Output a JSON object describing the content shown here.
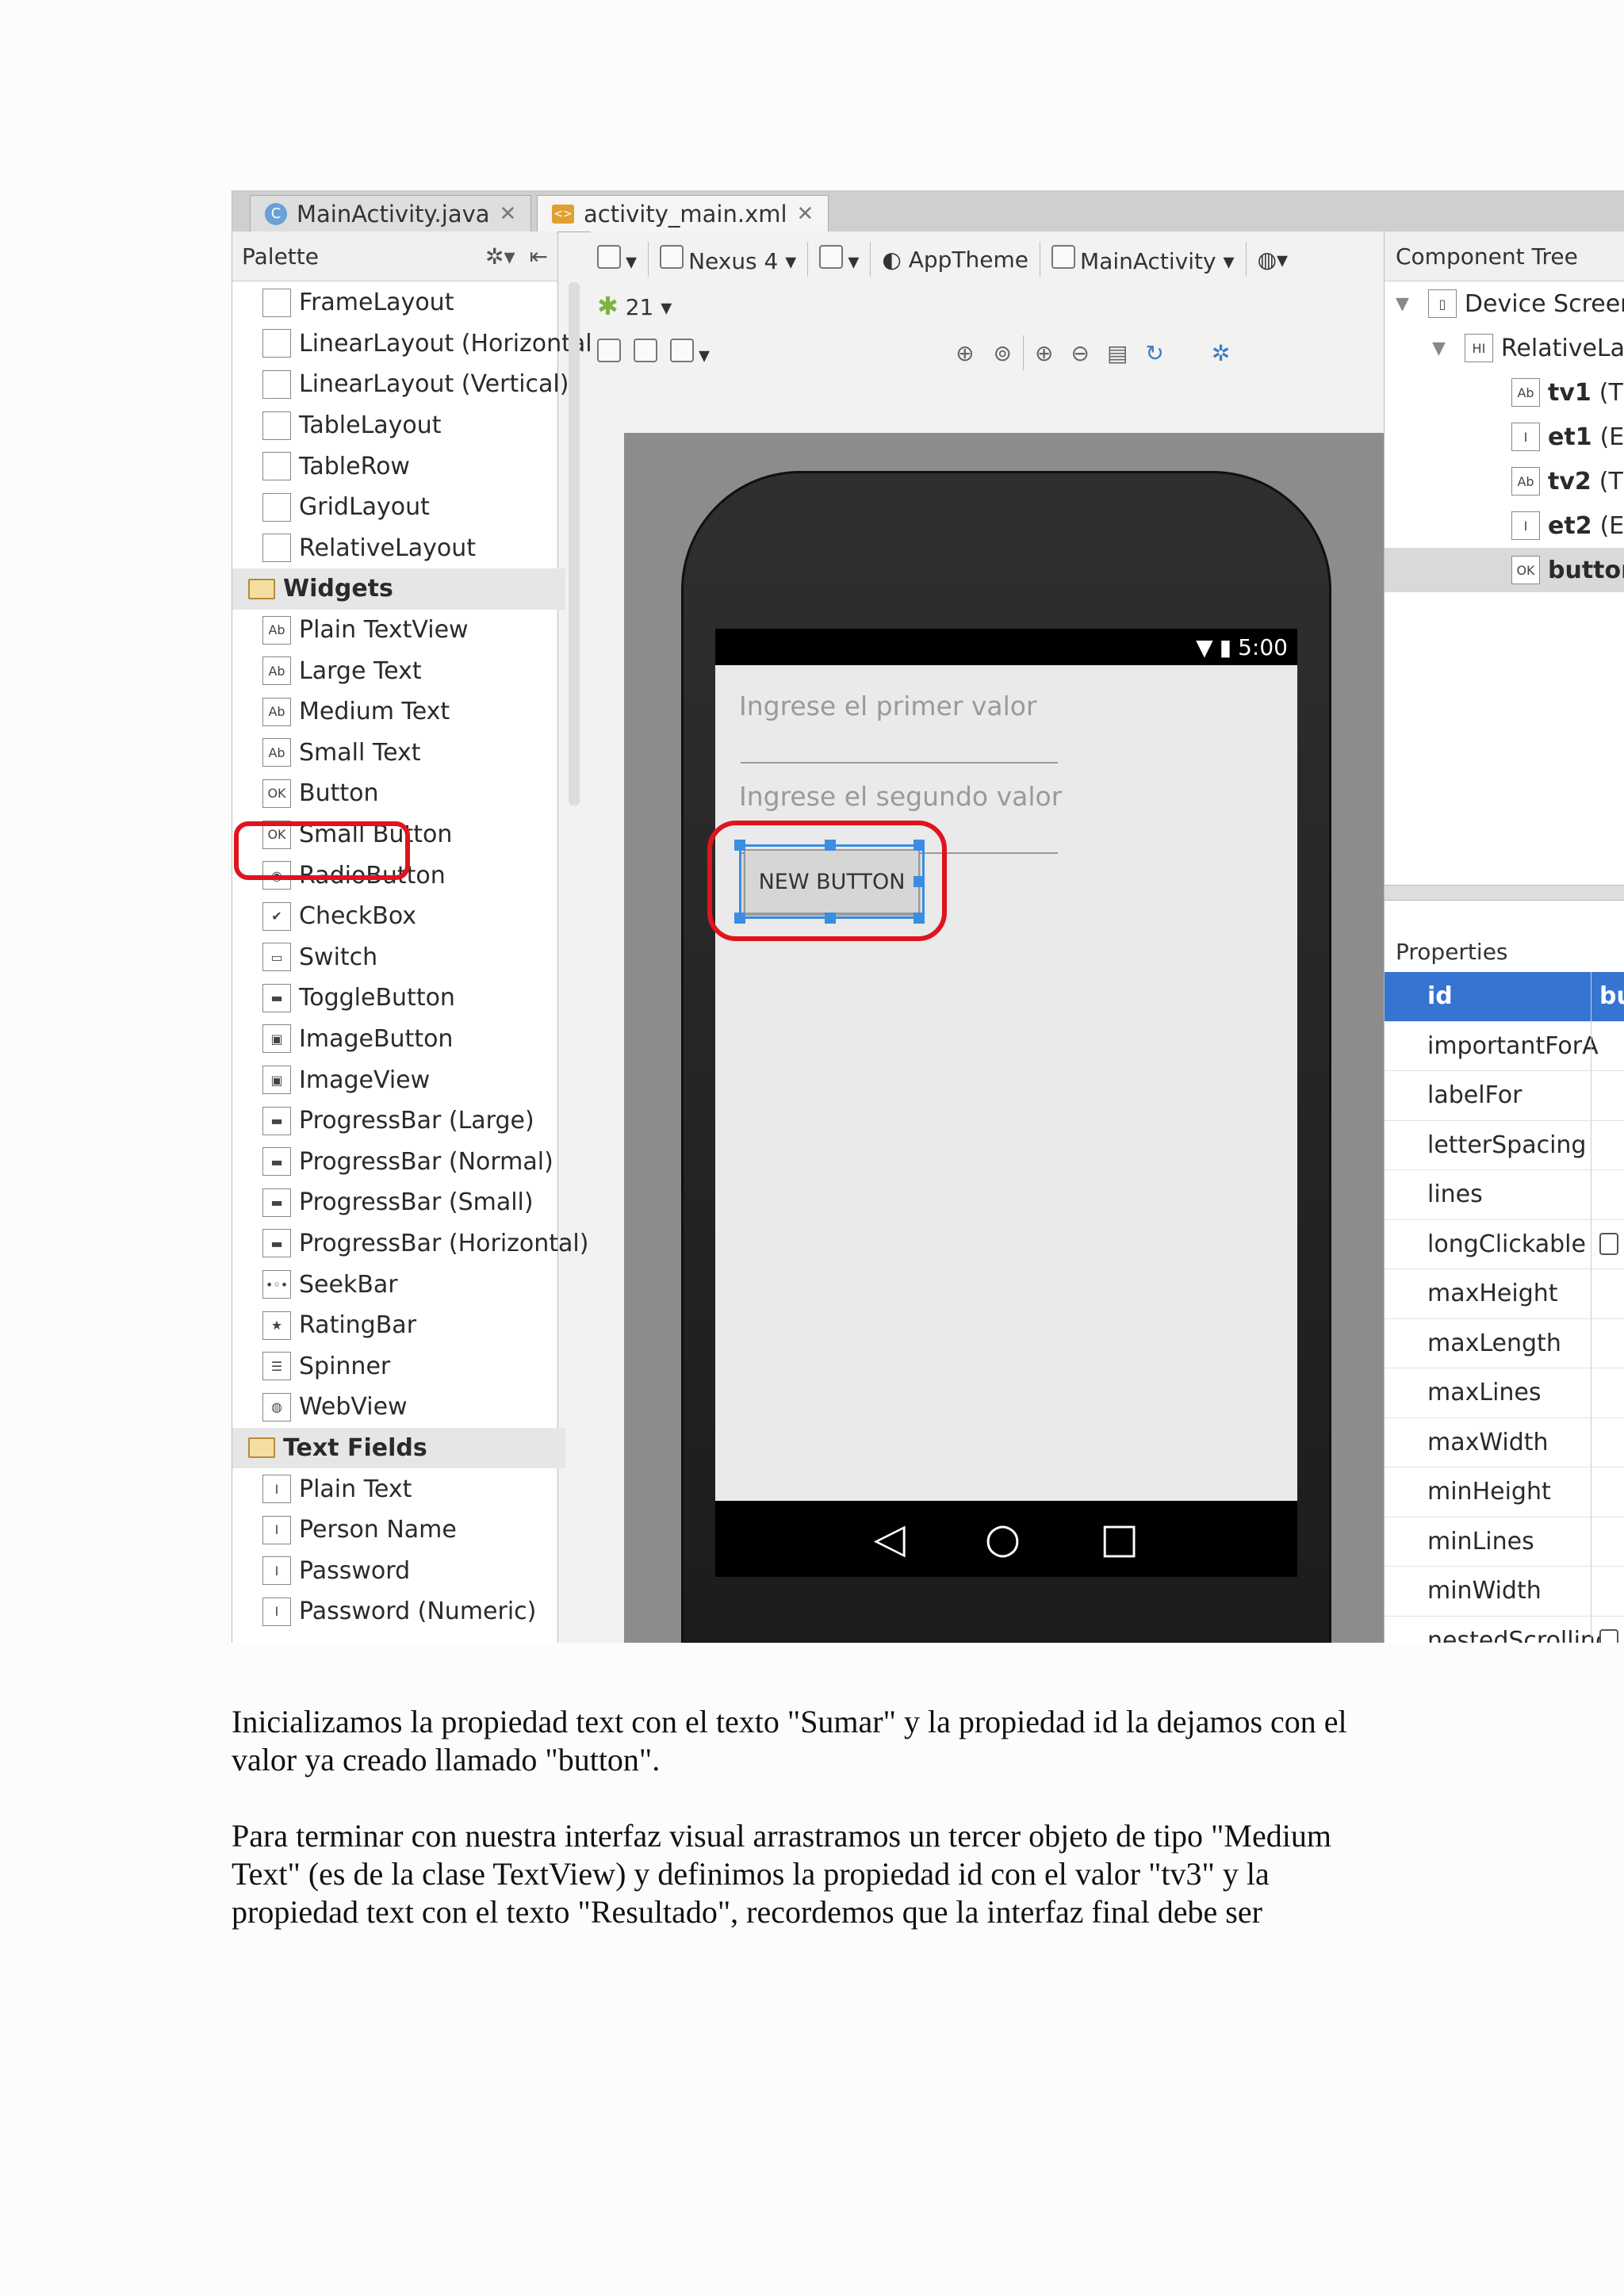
{
  "tabs": [
    {
      "label": "MainActivity.java",
      "icon": "c-class-icon"
    },
    {
      "label": "activity_main.xml",
      "icon": "xml-layout-icon"
    }
  ],
  "palette": {
    "title": "Palette",
    "items": [
      {
        "label": "FrameLayout",
        "glyph": ""
      },
      {
        "label": "LinearLayout (Horizontal",
        "glyph": ""
      },
      {
        "label": "LinearLayout (Vertical)",
        "glyph": ""
      },
      {
        "label": "TableLayout",
        "glyph": ""
      },
      {
        "label": "TableRow",
        "glyph": ""
      },
      {
        "label": "GridLayout",
        "glyph": ""
      },
      {
        "label": "RelativeLayout",
        "glyph": ""
      },
      {
        "label": "Widgets",
        "category": true
      },
      {
        "label": "Plain TextView",
        "glyph": "Ab"
      },
      {
        "label": "Large Text",
        "glyph": "Ab"
      },
      {
        "label": "Medium Text",
        "glyph": "Ab"
      },
      {
        "label": "Small Text",
        "glyph": "Ab"
      },
      {
        "label": "Button",
        "glyph": "OK"
      },
      {
        "label": "Small Button",
        "glyph": "OK"
      },
      {
        "label": "RadioButton",
        "glyph": "◉"
      },
      {
        "label": "CheckBox",
        "glyph": "✔"
      },
      {
        "label": "Switch",
        "glyph": "▭"
      },
      {
        "label": "ToggleButton",
        "glyph": "▬"
      },
      {
        "label": "ImageButton",
        "glyph": "▣"
      },
      {
        "label": "ImageView",
        "glyph": "▣"
      },
      {
        "label": "ProgressBar (Large)",
        "glyph": "▬"
      },
      {
        "label": "ProgressBar (Normal)",
        "glyph": "▬"
      },
      {
        "label": "ProgressBar (Small)",
        "glyph": "▬"
      },
      {
        "label": "ProgressBar (Horizontal)",
        "glyph": "▬"
      },
      {
        "label": "SeekBar",
        "glyph": "•◦•"
      },
      {
        "label": "RatingBar",
        "glyph": "★"
      },
      {
        "label": "Spinner",
        "glyph": "☰"
      },
      {
        "label": "WebView",
        "glyph": "◍"
      },
      {
        "label": "Text Fields",
        "category": true
      },
      {
        "label": "Plain Text",
        "glyph": "I"
      },
      {
        "label": "Person Name",
        "glyph": "I"
      },
      {
        "label": "Password",
        "glyph": "I"
      },
      {
        "label": "Password (Numeric)",
        "glyph": "I"
      }
    ]
  },
  "toolbar": {
    "device": "Nexus 4",
    "theme": "AppTheme",
    "activity": "MainActivity",
    "api": "21"
  },
  "phone": {
    "time": "5:00",
    "hint1": "Ingrese el primer valor",
    "hint2": "Ingrese el segundo valor",
    "button": "NEW BUTTON"
  },
  "component_tree": {
    "title": "Component Tree",
    "items": [
      {
        "label": "Device Screen",
        "bold": "",
        "rest": "Device Screen",
        "glyph": "▯"
      },
      {
        "label": "RelativeLay",
        "bold": "",
        "rest": "RelativeLay",
        "glyph": "HI"
      },
      {
        "bold": "tv1",
        "rest": " (T",
        "glyph": "Ab"
      },
      {
        "bold": "et1",
        "rest": " (Ec",
        "glyph": "I"
      },
      {
        "bold": "tv2",
        "rest": " (T",
        "glyph": "Ab"
      },
      {
        "bold": "et2",
        "rest": " (Ec",
        "glyph": "I"
      },
      {
        "bold": "buttor",
        "rest": "",
        "glyph": "OK"
      }
    ]
  },
  "properties": {
    "title": "Properties",
    "rows": [
      {
        "name": "id",
        "value": "bu"
      },
      {
        "name": "importantForA",
        "value": ""
      },
      {
        "name": "labelFor",
        "value": ""
      },
      {
        "name": "letterSpacing",
        "value": ""
      },
      {
        "name": "lines",
        "value": ""
      },
      {
        "name": "longClickable",
        "value": "",
        "checkbox": true
      },
      {
        "name": "maxHeight",
        "value": ""
      },
      {
        "name": "maxLength",
        "value": ""
      },
      {
        "name": "maxLines",
        "value": ""
      },
      {
        "name": "maxWidth",
        "value": ""
      },
      {
        "name": "minHeight",
        "value": ""
      },
      {
        "name": "minLines",
        "value": ""
      },
      {
        "name": "minWidth",
        "value": ""
      },
      {
        "name": "nestedScrolling",
        "value": "",
        "checkbox": true
      }
    ]
  },
  "text": {
    "p1": "Inicializamos la propiedad text con el texto \"Sumar\" y la propiedad id la dejamos con el valor ya creado llamado \"button\".",
    "p2": "Para terminar con nuestra interfaz visual arrastramos un tercer objeto de tipo \"Medium Text\" (es de la clase TextView) y definimos la propiedad id con el valor \"tv3\" y la propiedad text con el texto \"Resultado\", recordemos que la interfaz final debe ser"
  },
  "colors": {
    "highlight": "#e0141e",
    "selection": "#3a8de0",
    "selected_row": "#3574d0"
  }
}
